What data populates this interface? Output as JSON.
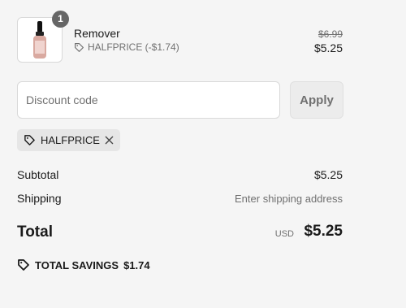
{
  "line_item": {
    "quantity": "1",
    "name": "Remover",
    "discount_label": "HALFPRICE (-$1.74)",
    "original_price": "$6.99",
    "price": "$5.25"
  },
  "discount_form": {
    "placeholder": "Discount code",
    "value": "",
    "apply_label": "Apply"
  },
  "applied_code": {
    "code": "HALFPRICE"
  },
  "summary": {
    "subtotal_label": "Subtotal",
    "subtotal_value": "$5.25",
    "shipping_label": "Shipping",
    "shipping_value": "Enter shipping address",
    "total_label": "Total",
    "currency": "USD",
    "total_value": "$5.25",
    "savings_label": "TOTAL SAVINGS",
    "savings_value": "$1.74"
  },
  "icons": {
    "tag": "tag-icon",
    "close": "close-icon",
    "product": "serum-bottle-image"
  },
  "colors": {
    "background": "#f5f5f5",
    "text": "#1a1a1a",
    "muted": "#707070",
    "badge": "#666666"
  }
}
